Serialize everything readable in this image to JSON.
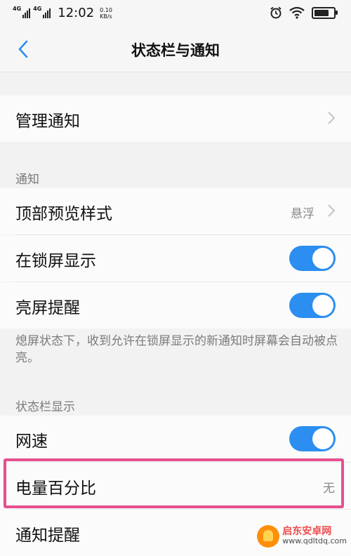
{
  "status": {
    "network1": "4G",
    "network2": "4G",
    "time": "12:02",
    "speed_value": "0.10",
    "speed_unit": "KB/s",
    "battery_level": 0.85
  },
  "header": {
    "title": "状态栏与通知",
    "back_icon": "back-arrow-icon"
  },
  "manage": {
    "label": "管理通知"
  },
  "notification_section": {
    "title": "通知",
    "items": [
      {
        "label": "顶部预览样式",
        "value": "悬浮"
      },
      {
        "label": "在锁屏显示",
        "on": true
      },
      {
        "label": "亮屏提醒",
        "on": true
      }
    ],
    "note": "熄屏状态下，收到允许在锁屏显示的新通知时屏幕会自动被点亮。"
  },
  "statusbar_section": {
    "title": "状态栏显示",
    "items": [
      {
        "label": "网速",
        "on": true
      },
      {
        "label": "电量百分比",
        "value": "无"
      },
      {
        "label": "通知提醒"
      }
    ]
  },
  "watermark": {
    "title": "启东安卓网",
    "url": "www.qdltdq.com"
  },
  "colors": {
    "accent": "#2b8ef0",
    "highlight": "#e5508f"
  }
}
